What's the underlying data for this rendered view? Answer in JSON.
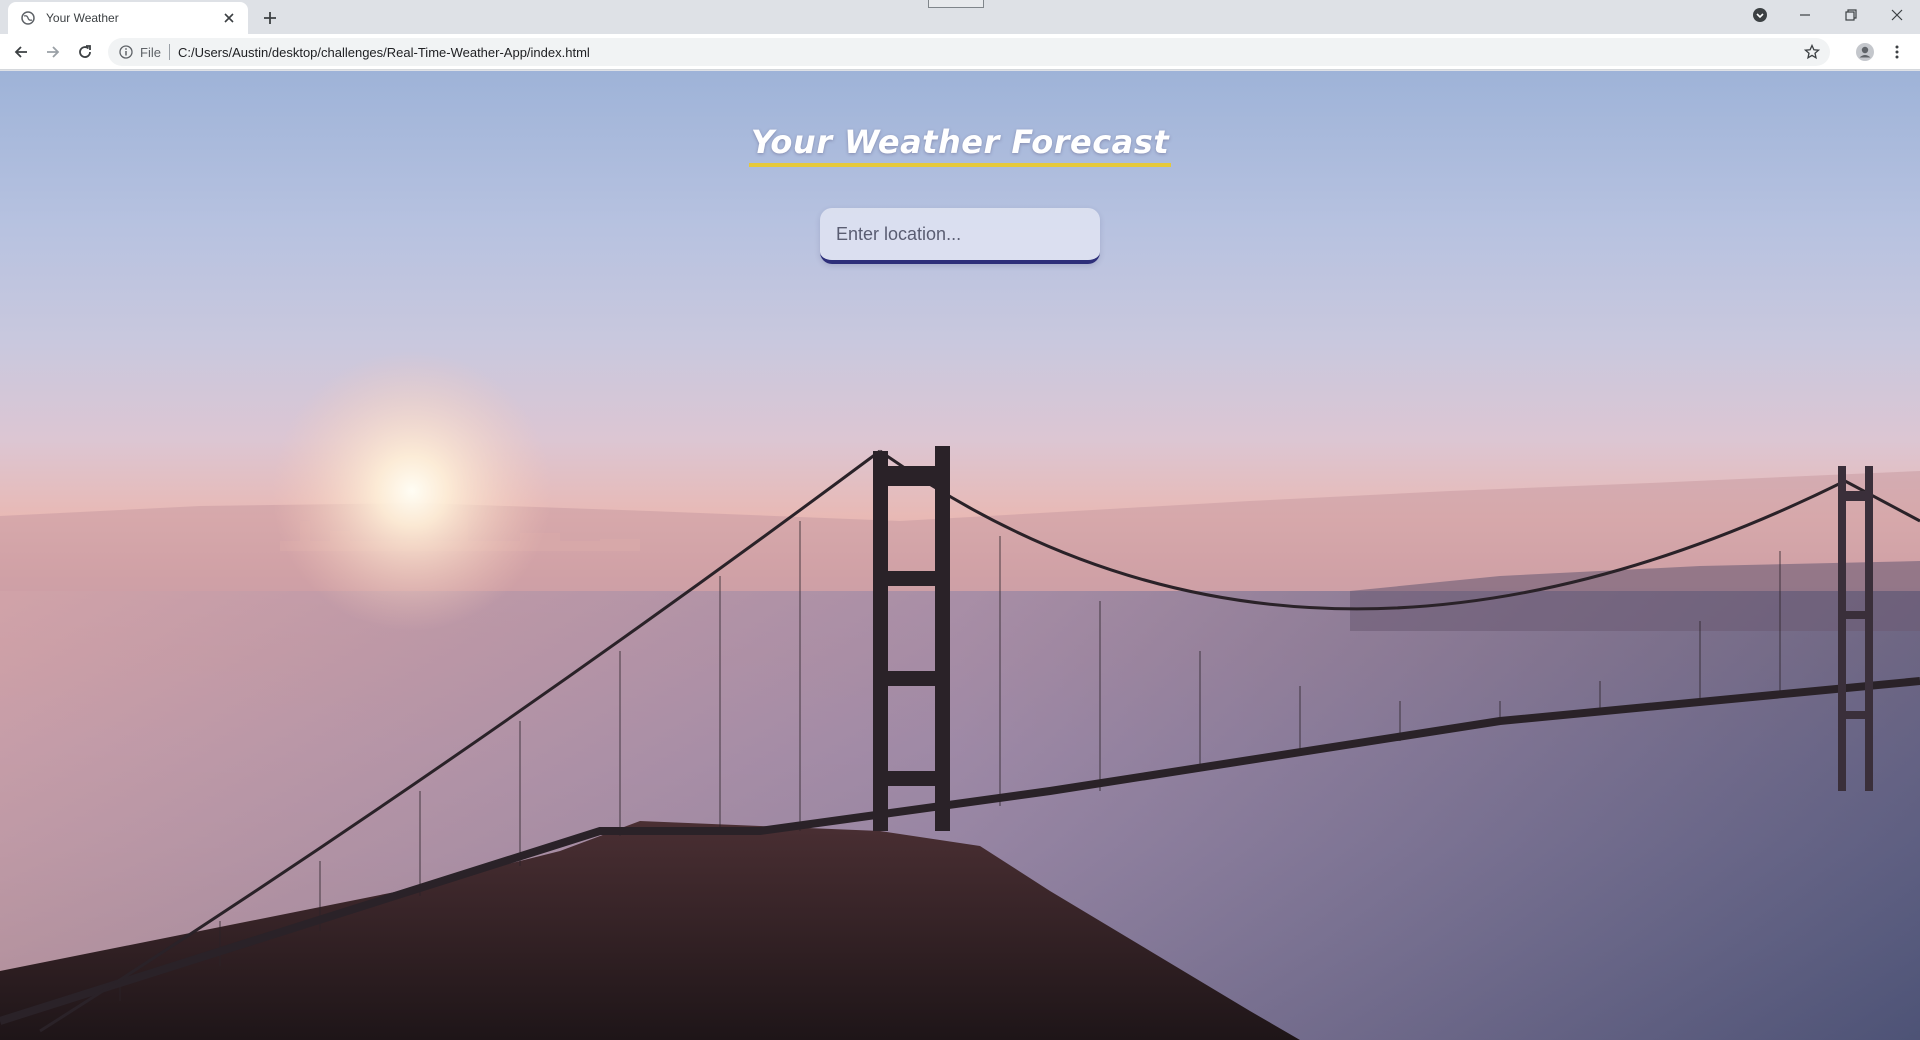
{
  "browser": {
    "tab": {
      "title": "Your Weather",
      "favicon": "globe-icon"
    },
    "address": {
      "scheme_label": "File",
      "url": "C:/Users/Austin/desktop/challenges/Real-Time-Weather-App/index.html"
    },
    "icons": {
      "back": "arrow-left-icon",
      "forward": "arrow-right-icon",
      "reload": "reload-icon",
      "info": "info-icon",
      "bookmark": "star-icon",
      "profile": "person-icon",
      "menu": "kebab-icon"
    }
  },
  "page": {
    "title": "Your Weather Forecast",
    "search": {
      "placeholder": "Enter location...",
      "value": ""
    }
  },
  "colors": {
    "title_underline": "#e6c93a",
    "input_border": "#2e2f7a"
  }
}
